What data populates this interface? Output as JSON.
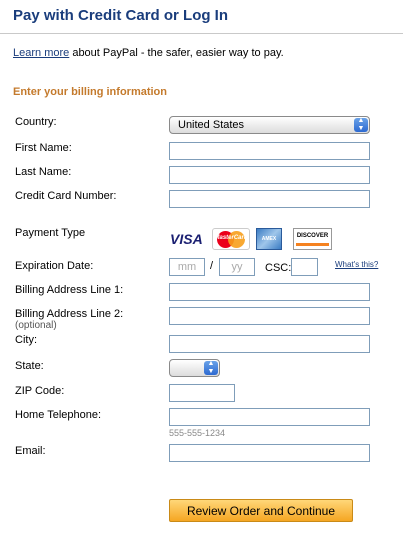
{
  "header": {
    "title": "Pay with Credit Card or Log In",
    "learn_more_link": "Learn more",
    "learn_more_text": " about PayPal - the safer, easier way to pay."
  },
  "form": {
    "section_title": "Enter your billing information",
    "country": {
      "label": "Country:",
      "value": "United States"
    },
    "first_name": {
      "label": "First Name:",
      "value": ""
    },
    "last_name": {
      "label": "Last Name:",
      "value": ""
    },
    "card_number": {
      "label": "Credit Card Number:",
      "value": ""
    },
    "payment_type": {
      "label": "Payment Type",
      "cards": [
        {
          "name": "visa-card-icon",
          "text": "VISA"
        },
        {
          "name": "mastercard-card-icon",
          "text": "MasterCard"
        },
        {
          "name": "amex-card-icon",
          "text": "AMEX"
        },
        {
          "name": "discover-card-icon",
          "text": "DISCOVER"
        }
      ]
    },
    "expiration": {
      "label": "Expiration Date:",
      "month_placeholder": "mm",
      "separator": "/",
      "year_placeholder": "yy",
      "csc_label": "CSC:",
      "whats_this": "What's this?"
    },
    "address1": {
      "label": "Billing Address Line 1:",
      "value": ""
    },
    "address2": {
      "label": "Billing Address Line 2:",
      "optional": "(optional)",
      "value": ""
    },
    "city": {
      "label": "City:",
      "value": ""
    },
    "state": {
      "label": "State:",
      "value": ""
    },
    "zip": {
      "label": "ZIP Code:",
      "value": ""
    },
    "phone": {
      "label": "Home Telephone:",
      "value": "",
      "hint": "555-555-1234"
    },
    "email": {
      "label": "Email:",
      "value": ""
    },
    "submit_label": "Review Order and Continue"
  },
  "colors": {
    "title": "#1a3d7c",
    "section": "#c47a2c",
    "button": "#f5a623"
  }
}
